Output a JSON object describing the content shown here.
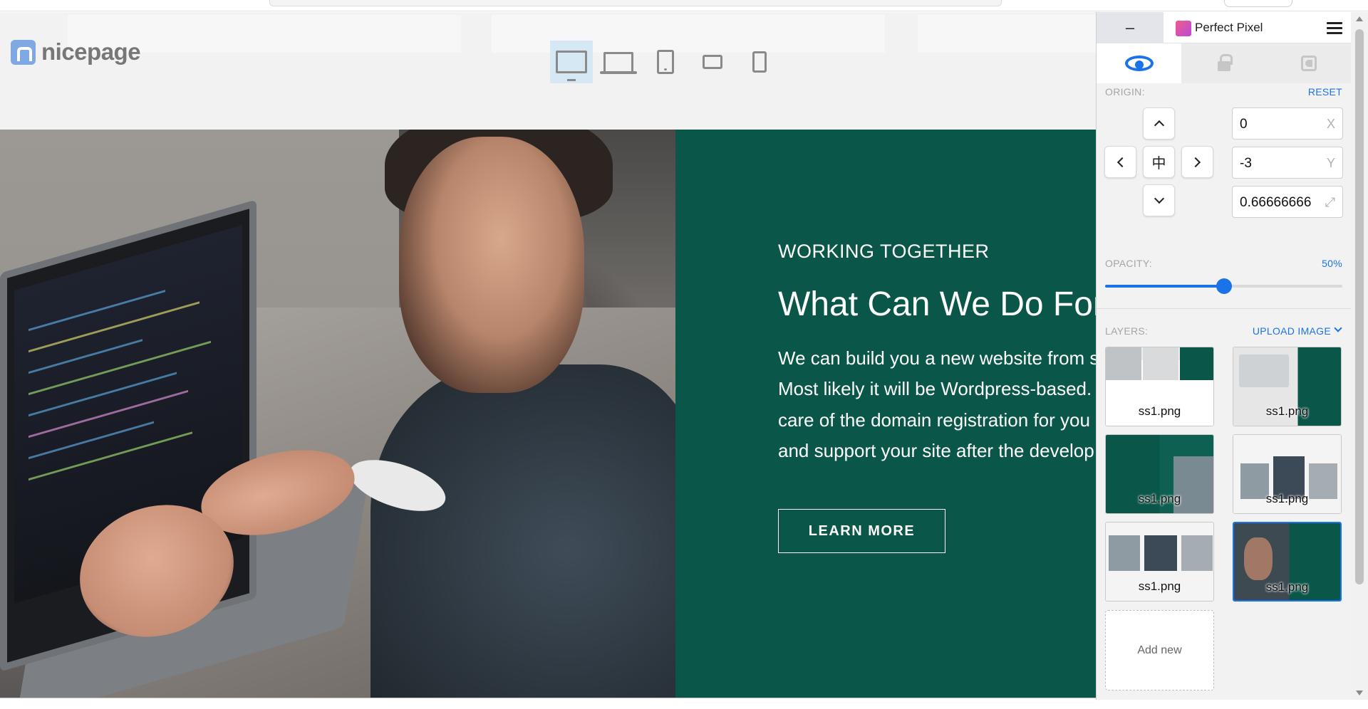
{
  "brand": {
    "name": "nicepage"
  },
  "devices": [
    {
      "icon": "desktop-icon",
      "active": true
    },
    {
      "icon": "laptop-icon",
      "active": false
    },
    {
      "icon": "tablet-icon",
      "active": false
    },
    {
      "icon": "tablet-landscape-icon",
      "active": false
    },
    {
      "icon": "phone-icon",
      "active": false
    }
  ],
  "hero": {
    "kicker": "WORKING TOGETHER",
    "headline": "What Can We Do For Y",
    "body_lines": [
      "We can build you a new website from s",
      "Most likely it will be Wordpress-based.",
      "care of the domain registration for you",
      "and support your site after the develop"
    ],
    "cta": "LEARN MORE",
    "green_color": "#0a574a"
  },
  "perfect_pixel": {
    "title": "Perfect Pixel",
    "minimize": "–",
    "origin": {
      "label": "ORIGIN:",
      "reset": "RESET",
      "x_value": "0",
      "x_unit": "X",
      "y_value": "-3",
      "y_unit": "Y",
      "scale_value": "0.66666666",
      "scale_icon": "⤢"
    },
    "opacity": {
      "label": "OPACITY:",
      "value_label": "50%",
      "value": 0.5
    },
    "layers": {
      "label": "LAYERS:",
      "upload": "UPLOAD IMAGE",
      "items": [
        {
          "name": "ss1.png",
          "selected": false
        },
        {
          "name": "ss1.png",
          "selected": false
        },
        {
          "name": "ss1.png",
          "selected": false
        },
        {
          "name": "ss1.png",
          "selected": false
        },
        {
          "name": "ss1.png",
          "selected": false
        },
        {
          "name": "ss1.png",
          "selected": true
        }
      ],
      "add_new": "Add new"
    },
    "accent": "#1a73e8"
  }
}
